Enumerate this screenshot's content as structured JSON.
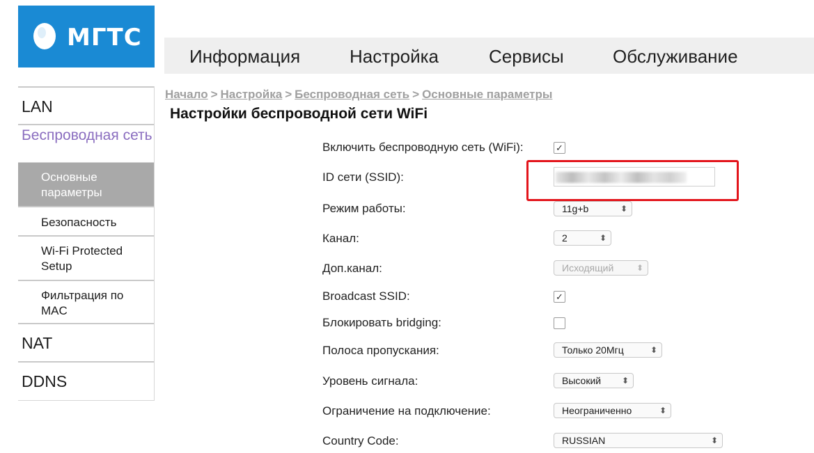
{
  "brand": {
    "name": "МГТС",
    "color": "#1a8ad4"
  },
  "topnav": {
    "items": [
      "Информация",
      "Настройка",
      "Сервисы",
      "Обслуживание"
    ]
  },
  "sidebar": {
    "lan": "LAN",
    "wireless": "Беспроводная сеть",
    "sub": {
      "basic": "Основные параметры",
      "security": "Безопасность",
      "wps": "Wi-Fi Protected Setup",
      "mac_filter": "Фильтрация по MAC"
    },
    "nat": "NAT",
    "ddns": "DDNS"
  },
  "breadcrumb": [
    "Начало",
    "Настройка",
    "Беспроводная сеть",
    "Основные параметры"
  ],
  "breadcrumb_sep": ">",
  "page_title": "Настройки беспроводной сети WiFi",
  "form": {
    "enable_wifi": {
      "label": "Включить беспроводную сеть (WiFi):",
      "checked": true
    },
    "ssid": {
      "label": "ID сети (SSID):",
      "value_obscured": true
    },
    "mode": {
      "label": "Режим работы:",
      "value": "11g+b"
    },
    "channel": {
      "label": "Канал:",
      "value": "2"
    },
    "ext_channel": {
      "label": "Доп.канал:",
      "value": "Исходящий",
      "disabled": true
    },
    "broadcast_ssid": {
      "label": "Broadcast SSID:",
      "checked": true
    },
    "block_bridging": {
      "label": "Блокировать bridging:",
      "checked": false
    },
    "bandwidth": {
      "label": "Полоса пропускания:",
      "value": "Только 20Мгц"
    },
    "signal_level": {
      "label": "Уровень сигнала:",
      "value": "Высокий"
    },
    "connection_limit": {
      "label": "Ограничение на подключение:",
      "value": "Неограниченно"
    },
    "country_code": {
      "label": "Country Code:",
      "value": "RUSSIAN"
    }
  },
  "icons": {
    "check": "checkmark-icon",
    "select_arrow": "updown-chevron-icon"
  },
  "highlight_color": "#e3141b"
}
